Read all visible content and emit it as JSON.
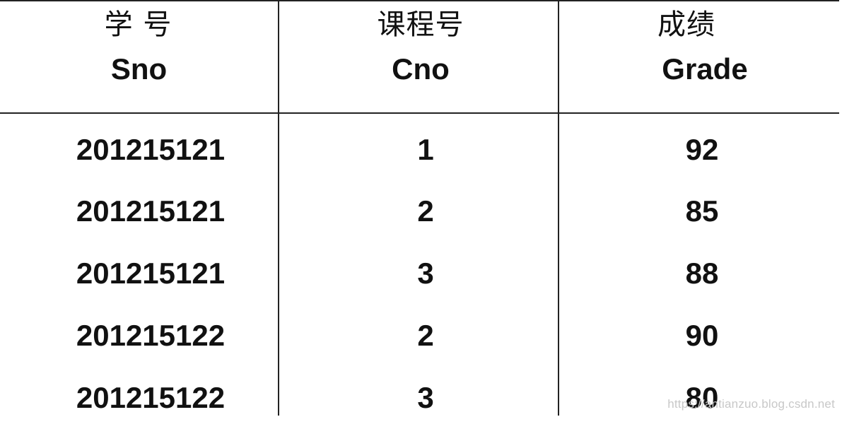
{
  "table": {
    "headers": [
      {
        "cn": "学 号",
        "en": "Sno"
      },
      {
        "cn": "课程号",
        "en": "Cno"
      },
      {
        "cn": "成绩",
        "en": "Grade"
      }
    ],
    "rows": [
      {
        "sno": "201215121",
        "cno": "1",
        "grade": "92"
      },
      {
        "sno": "201215121",
        "cno": "2",
        "grade": "85"
      },
      {
        "sno": "201215121",
        "cno": "3",
        "grade": "88"
      },
      {
        "sno": "201215122",
        "cno": "2",
        "grade": "90"
      },
      {
        "sno": "201215122",
        "cno": "3",
        "grade": "80"
      }
    ]
  },
  "watermark": "https://antianzuo.blog.csdn.net"
}
